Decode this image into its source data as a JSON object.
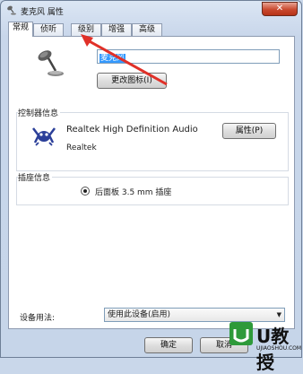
{
  "window": {
    "title": "麦克风 属性",
    "close_glyph": "✕"
  },
  "tabs": [
    {
      "label": "常规",
      "active": true
    },
    {
      "label": "侦听",
      "active": false
    },
    {
      "label": "级别",
      "active": false
    },
    {
      "label": "增强",
      "active": false
    },
    {
      "label": "高级",
      "active": false
    }
  ],
  "device": {
    "name_value": "麦克风",
    "change_icon_label": "更改图标(I)"
  },
  "controller": {
    "group_label": "控制器信息",
    "name": "Realtek High Definition Audio",
    "vendor": "Realtek",
    "properties_label": "属性(P)"
  },
  "jack": {
    "group_label": "插座信息",
    "description": "后面板 3.5 mm 插座"
  },
  "usage": {
    "label": "设备用法:",
    "selected": "使用此设备(启用)"
  },
  "footer": {
    "ok_label": "确定",
    "cancel_label": "取消"
  },
  "watermark": {
    "brand": "U教授",
    "site": "UJIAOSHOU.COM"
  },
  "colors": {
    "annotation_arrow": "#e03028",
    "selection": "#3399ff"
  }
}
